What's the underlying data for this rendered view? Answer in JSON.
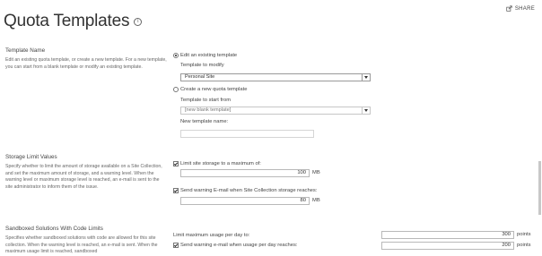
{
  "header": {
    "share_label": "SHARE",
    "title": "Quota Templates",
    "info_icon": "i"
  },
  "template_name": {
    "title": "Template Name",
    "description": "Edit an existing quota template, or create a new template. For a new template, you can start from a blank template or modify an existing template.",
    "edit_option": "Edit an existing template",
    "template_to_modify_label": "Template to modify",
    "template_to_modify_value": "Personal Site",
    "create_option": "Create a new quota template",
    "template_start_label": "Template to start from",
    "template_start_value": "[new blank template]",
    "new_name_label": "New template name:",
    "new_name_value": ""
  },
  "storage": {
    "title": "Storage Limit Values",
    "description": "Specify whether to limit the amount of storage available on a Site Collection, and set the maximum amount of storage, and a warning level. When the warning level or maximum storage level is reached, an e-mail is sent to the site administrator to inform them of the issue.",
    "limit_label": "Limit site storage to a maximum of:",
    "limit_value": "100",
    "limit_unit": "MB",
    "warn_label": "Send warning E-mail when Site Collection storage reaches:",
    "warn_value": "80",
    "warn_unit": "MB"
  },
  "sandboxed": {
    "title": "Sandboxed Solutions With Code Limits",
    "description": "Specifies whether sandboxed solutions with code are allowed for this site collection. When the warning level is reached, an e-mail is sent. When the maximum usage limit is reached, sandboxed",
    "limit_label": "Limit maximum usage per day to:",
    "limit_value": "300",
    "limit_unit": "points",
    "warn_label": "Send warning e-mail when usage per day reaches:",
    "warn_value": "200",
    "warn_unit": "points"
  }
}
